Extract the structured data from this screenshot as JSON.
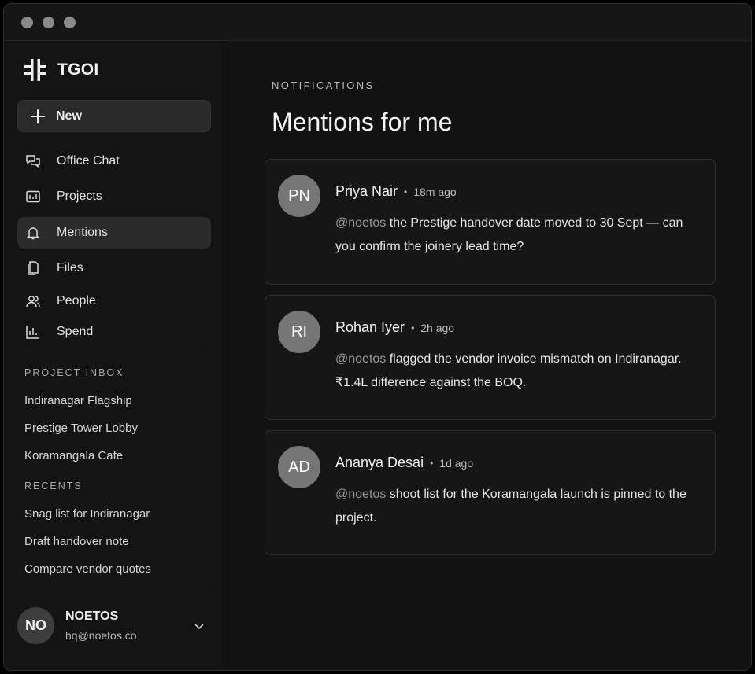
{
  "brand": {
    "name": "TGOI"
  },
  "sidebar": {
    "new_label": "New",
    "items": [
      {
        "label": "Office Chat",
        "icon": "chat-icon"
      },
      {
        "label": "Projects",
        "icon": "projects-icon"
      },
      {
        "label": "Mentions",
        "icon": "bell-icon",
        "active": true
      },
      {
        "label": "Files",
        "icon": "files-icon"
      },
      {
        "label": "People",
        "icon": "people-icon"
      },
      {
        "label": "Spend",
        "icon": "bar-chart-icon"
      }
    ],
    "project_inbox": {
      "title": "PROJECT INBOX",
      "items": [
        "Indiranagar Flagship",
        "Prestige Tower Lobby",
        "Koramangala Cafe"
      ]
    },
    "recents": {
      "title": "RECENTS",
      "items": [
        "Snag list for Indiranagar",
        "Draft handover note",
        "Compare vendor quotes"
      ]
    },
    "user": {
      "initials": "NO",
      "name": "NOETOS",
      "email": "hq@noetos.co"
    }
  },
  "main": {
    "eyebrow": "NOTIFICATIONS",
    "title": "Mentions for me",
    "mentions": [
      {
        "initials": "PN",
        "name": "Priya Nair",
        "separator": "•",
        "time": "18m ago",
        "tag": "@noetos",
        "text": " the Prestige handover date moved to 30 Sept — can you confirm the joinery lead time?"
      },
      {
        "initials": "RI",
        "name": "Rohan Iyer",
        "separator": "•",
        "time": "2h ago",
        "tag": "@noetos",
        "text": " flagged the vendor invoice mismatch on Indiranagar. ₹1.4L difference against the BOQ."
      },
      {
        "initials": "AD",
        "name": "Ananya Desai",
        "separator": "•",
        "time": "1d ago",
        "tag": "@noetos",
        "text": " shoot list for the Koramangala launch is pinned to the project."
      }
    ]
  }
}
